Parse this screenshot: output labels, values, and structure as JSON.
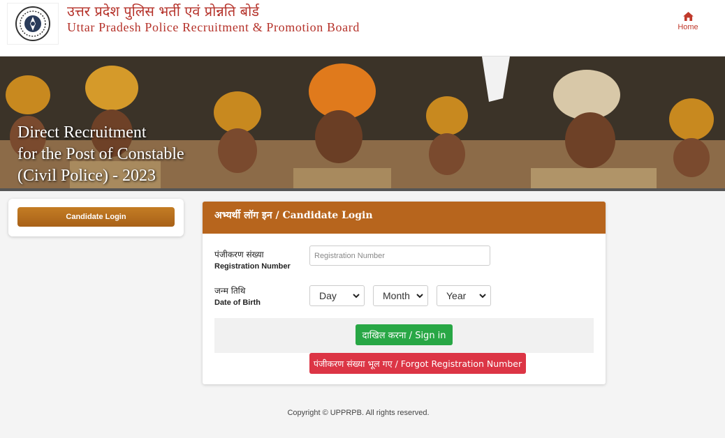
{
  "header": {
    "title_hindi": "उत्तर प्रदेश पुलिस भर्ती एवं प्रोन्नति बोर्ड",
    "title_english": "Uttar Pradesh Police Recruitment & Promotion Board",
    "home_label": "Home"
  },
  "banner": {
    "line1": "Direct Recruitment",
    "line2": "for the Post of Constable",
    "line3": "(Civil Police) - 2023"
  },
  "sidebar": {
    "button_label": "Candidate Login"
  },
  "login": {
    "heading": "अभ्यर्थी लॉग इन / Candidate Login",
    "reg_label_hi": "पंजीकरण संख्या",
    "reg_label_en": "Registration Number",
    "reg_placeholder": "Registration Number",
    "dob_label_hi": "जन्म तिथि",
    "dob_label_en": "Date of Birth",
    "day": "Day",
    "month": "Month",
    "year": "Year",
    "signin_label": "दाखिल करना / Sign in",
    "forgot_label": "पंजीकरण संख्या भूल गए / Forgot Registration Number"
  },
  "footer": {
    "copyright": "Copyright © UPPRPB. All rights reserved."
  },
  "colors": {
    "brand_red": "#b5322a",
    "login_header": "#b7651d",
    "signin_green": "#28a745",
    "forgot_red": "#dc3545"
  },
  "icons": {
    "home": "home-icon",
    "logo": "emblem-logo",
    "dropdown": "chevron-down-icon"
  }
}
